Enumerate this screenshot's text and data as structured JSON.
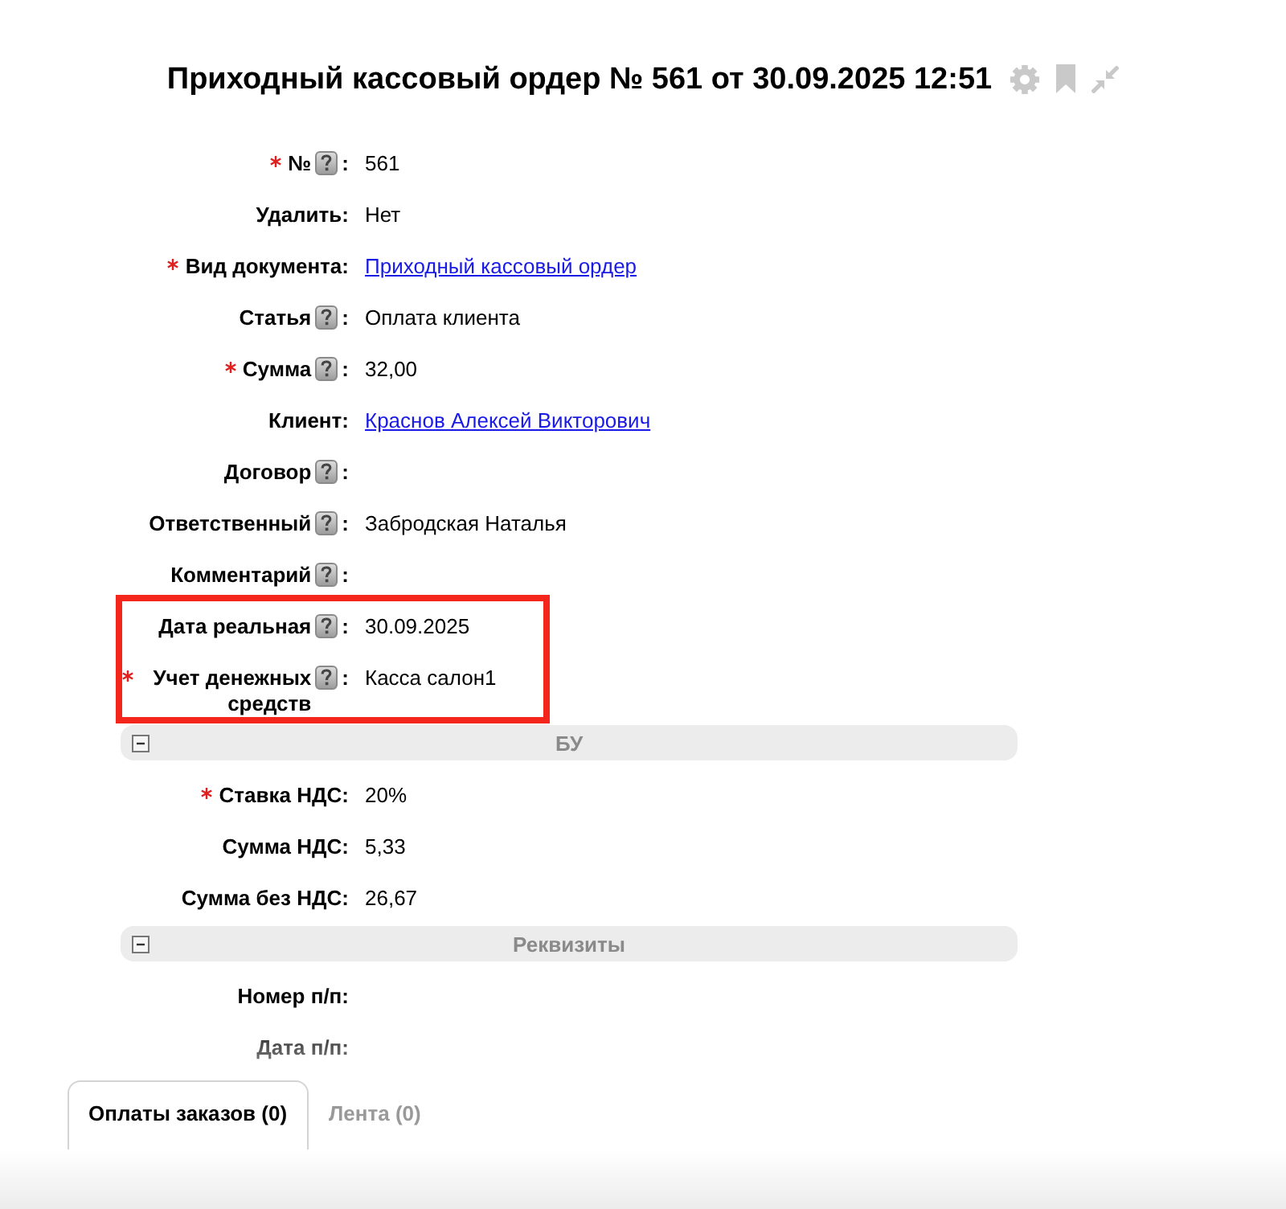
{
  "title": "Приходный кассовый ордер № 561 от 30.09.2025 12:51",
  "fields": [
    {
      "label": "№",
      "colon": ":",
      "required": true,
      "help": true,
      "highlighted": false,
      "kind": "text",
      "value": "561"
    },
    {
      "label": "Удалить",
      "colon": ":",
      "required": false,
      "help": false,
      "highlighted": false,
      "kind": "text",
      "value": "Нет"
    },
    {
      "label": "Вид документа",
      "colon": ":",
      "required": true,
      "help": false,
      "highlighted": false,
      "kind": "link",
      "value": "Приходный кассовый ордер"
    },
    {
      "label": "Статья",
      "colon": ":",
      "required": false,
      "help": true,
      "highlighted": false,
      "kind": "text",
      "value": "Оплата клиента"
    },
    {
      "label": "Сумма",
      "colon": ":",
      "required": true,
      "help": true,
      "highlighted": false,
      "kind": "text",
      "value": "32,00"
    },
    {
      "label": "Клиент",
      "colon": ":",
      "required": false,
      "help": false,
      "highlighted": false,
      "kind": "link",
      "value": "Краснов Алексей Викторович"
    },
    {
      "label": "Договор",
      "colon": ":",
      "required": false,
      "help": true,
      "highlighted": false,
      "kind": "text"
    },
    {
      "label": "Ответственный",
      "colon": ":",
      "required": false,
      "help": true,
      "highlighted": false,
      "kind": "text",
      "value": "Забродская Наталья"
    },
    {
      "label": "Комментарий",
      "colon": ":",
      "required": false,
      "help": true,
      "highlighted": false,
      "kind": "text"
    },
    {
      "label": "Дата реальная",
      "colon": ":",
      "required": false,
      "help": true,
      "highlighted": true,
      "kind": "text",
      "value": "30.09.2025"
    },
    {
      "label": "Учет денежных средств",
      "colon": ":",
      "required": true,
      "help": true,
      "highlighted": true,
      "kind": "text",
      "value": "Касса салон1"
    }
  ],
  "sections": [
    {
      "title": "БУ",
      "expanded": true,
      "fields": [
        {
          "label": "Ставка НДС",
          "colon": ":",
          "required": true,
          "help": false,
          "kind": "text",
          "value": "20%"
        },
        {
          "label": "Сумма НДС",
          "colon": ":",
          "required": false,
          "help": false,
          "kind": "text",
          "value": "5,33"
        },
        {
          "label": "Сумма без НДС",
          "colon": ":",
          "required": false,
          "help": false,
          "kind": "text",
          "value": "26,67"
        }
      ]
    },
    {
      "title": "Реквизиты",
      "expanded": true,
      "fields": [
        {
          "label": "Номер п/п",
          "colon": ":",
          "required": false,
          "help": false,
          "kind": "text"
        },
        {
          "label": "Дата п/п",
          "colon": ":",
          "required": false,
          "help": false,
          "kind": "text"
        }
      ]
    }
  ],
  "tabs": [
    {
      "label": "Оплаты заказов (0)",
      "selected": true
    },
    {
      "label": "Лента (0)",
      "selected": false
    }
  ]
}
